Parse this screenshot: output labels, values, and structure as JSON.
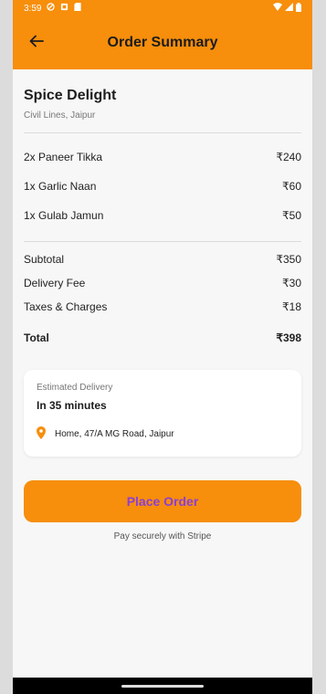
{
  "status_bar": {
    "time": "3:59"
  },
  "header": {
    "title": "Order Summary",
    "back_icon": "arrow-left-icon"
  },
  "restaurant": {
    "name": "Spice Delight",
    "address": "Civil Lines, Jaipur"
  },
  "items": [
    {
      "name": "2x Paneer Tikka",
      "price": "₹240"
    },
    {
      "name": "1x Garlic Naan",
      "price": "₹60"
    },
    {
      "name": "1x Gulab Jamun",
      "price": "₹50"
    }
  ],
  "summary": {
    "subtotal_label": "Subtotal",
    "subtotal": "₹350",
    "delivery_label": "Delivery Fee",
    "delivery": "₹30",
    "taxes_label": "Taxes & Charges",
    "taxes": "₹18",
    "total_label": "Total",
    "total": "₹398"
  },
  "delivery": {
    "label": "Estimated Delivery",
    "eta": "In 35 minutes",
    "address": "Home, 47/A MG Road, Jaipur",
    "pin_icon": "location-pin-icon"
  },
  "actions": {
    "place_order": "Place Order",
    "pay_note": "Pay securely with Stripe"
  },
  "colors": {
    "accent": "#f78e0c",
    "button_text": "#8b3fd6",
    "background": "#f7f7f7"
  }
}
